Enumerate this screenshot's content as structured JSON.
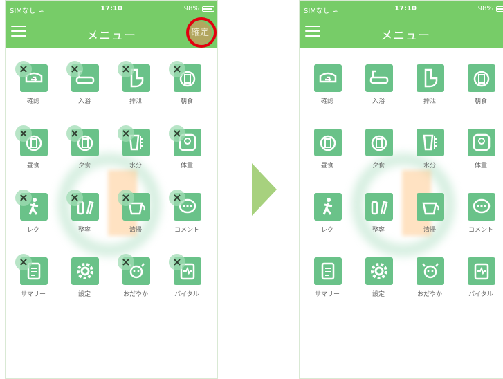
{
  "status": {
    "carrier": "SIMなし ≈",
    "time": "17:10",
    "battery": "98%"
  },
  "nav": {
    "title": "メニュー",
    "confirm_label": "確定"
  },
  "colors": {
    "header": "#77cc68",
    "tile": "#6ac289",
    "highlight": "#e3000f",
    "arrow": "#a7d17e"
  },
  "delete_mark": "×",
  "menu_items": [
    {
      "label": "確認",
      "icon": "nurse-cap-icon"
    },
    {
      "label": "入浴",
      "icon": "bathtub-icon"
    },
    {
      "label": "排泄",
      "icon": "toilet-icon"
    },
    {
      "label": "朝食",
      "icon": "breakfast-icon"
    },
    {
      "label": "昼食",
      "icon": "lunch-icon"
    },
    {
      "label": "夕食",
      "icon": "dinner-icon"
    },
    {
      "label": "水分",
      "icon": "water-glass-icon"
    },
    {
      "label": "体重",
      "icon": "scale-icon"
    },
    {
      "label": "レク",
      "icon": "walking-person-icon"
    },
    {
      "label": "整容",
      "icon": "grooming-icon"
    },
    {
      "label": "清掃",
      "icon": "cleaning-bucket-icon"
    },
    {
      "label": "コメント",
      "icon": "comment-bubble-icon"
    },
    {
      "label": "サマリー",
      "icon": "summary-document-icon"
    },
    {
      "label": "設定",
      "icon": "gear-icon"
    },
    {
      "label": "おだやか",
      "icon": "calm-face-icon"
    },
    {
      "label": "バイタル",
      "icon": "vital-clipboard-icon"
    }
  ],
  "edit_mode_badges": [
    true,
    true,
    true,
    true,
    true,
    true,
    true,
    true,
    true,
    true,
    true,
    true,
    true,
    false,
    true,
    true
  ]
}
